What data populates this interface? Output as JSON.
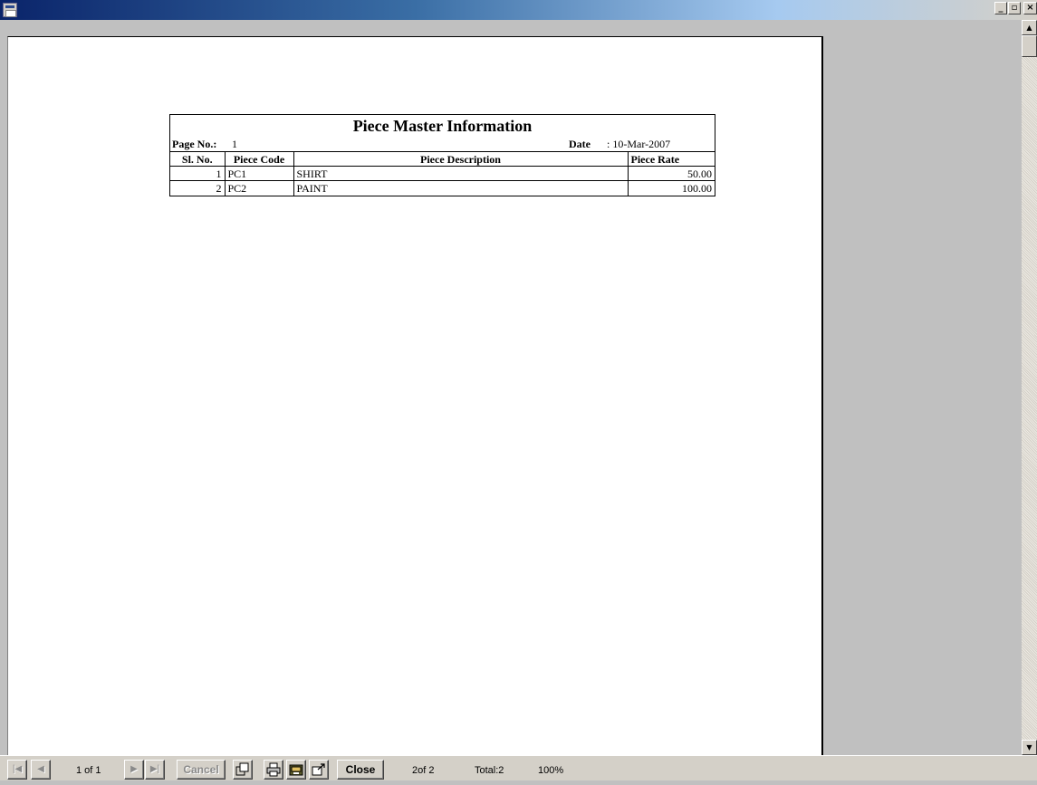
{
  "window": {
    "min_glyph": "_",
    "max_glyph": "▫",
    "close_glyph": "×"
  },
  "report": {
    "title": "Piece Master Information",
    "page_no_label": "Page No.:",
    "page_no_value": "1",
    "date_label": "Date",
    "date_value": ": 10-Mar-2007",
    "columns": [
      "Sl. No.",
      "Piece Code",
      "Piece Description",
      "Piece Rate"
    ],
    "rows": [
      {
        "sl": "1",
        "code": "PC1",
        "description": "SHIRT",
        "rate": "50.00"
      },
      {
        "sl": "2",
        "code": "PC2",
        "description": "PAINT",
        "rate": "100.00"
      }
    ]
  },
  "toolbar": {
    "first_glyph": "|◀",
    "prev_glyph": "◀",
    "next_glyph": "▶",
    "last_glyph": "▶|",
    "page_counter": "1 of 1",
    "cancel_label": "Cancel",
    "close_label": "Close",
    "record_counter": "2of 2",
    "total": "Total:2",
    "zoom": "100%",
    "icons": [
      "zoom-icon",
      "print-icon",
      "print-setup-icon",
      "export-icon"
    ]
  },
  "scrollbar": {
    "up_glyph": "▲",
    "down_glyph": "▼"
  },
  "colors": {
    "title_bar_start": "#0a246a",
    "title_bar_end": "#d4d0c8",
    "workspace": "#c0c0c0",
    "chrome": "#d4d0c8"
  }
}
